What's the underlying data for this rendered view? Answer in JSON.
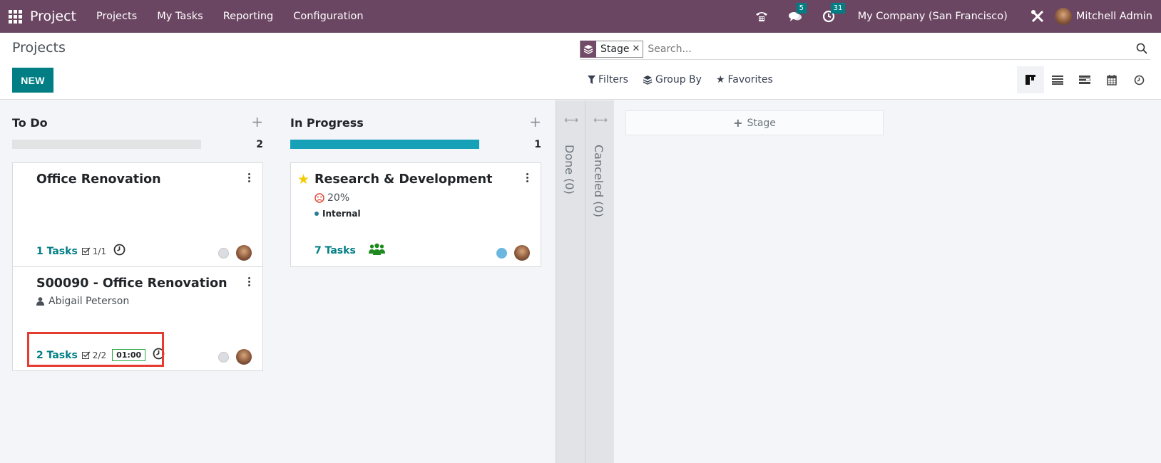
{
  "navbar": {
    "app_name": "Project",
    "menu": [
      "Projects",
      "My Tasks",
      "Reporting",
      "Configuration"
    ],
    "messages_count": "5",
    "activities_count": "31",
    "company": "My Company (San Francisco)",
    "user": "Mitchell Admin",
    "badge_color": "#017e84",
    "bg_color": "#6b4662"
  },
  "control": {
    "title": "Projects",
    "new_label": "NEW",
    "search": {
      "facet_label": "Stage",
      "placeholder": "Search..."
    },
    "filters_label": "Filters",
    "groupby_label": "Group By",
    "favorites_label": "Favorites",
    "views": [
      "kanban",
      "list",
      "gantt",
      "calendar",
      "activity"
    ],
    "active_view": "kanban"
  },
  "kanban": {
    "columns": [
      {
        "title": "To Do",
        "count": "2",
        "progress": 0,
        "cards": [
          {
            "title": "Office Renovation",
            "tasks": "1 Tasks",
            "checklist": "1/1",
            "status": "grey"
          },
          {
            "title": "S00090 - Office Renovation",
            "customer": "Abigail Peterson",
            "tasks": "2 Tasks",
            "checklist": "2/2",
            "time": "01:00",
            "status": "grey"
          }
        ]
      },
      {
        "title": "In Progress",
        "count": "1",
        "progress": 100,
        "cards": [
          {
            "title": "Research & Development",
            "favorite": true,
            "rating": "20%",
            "tag": "Internal",
            "tasks": "7 Tasks",
            "status": "blue"
          }
        ]
      }
    ],
    "folded": [
      "Done (0)",
      "Canceled (0)"
    ],
    "add_stage_label": "Stage"
  }
}
